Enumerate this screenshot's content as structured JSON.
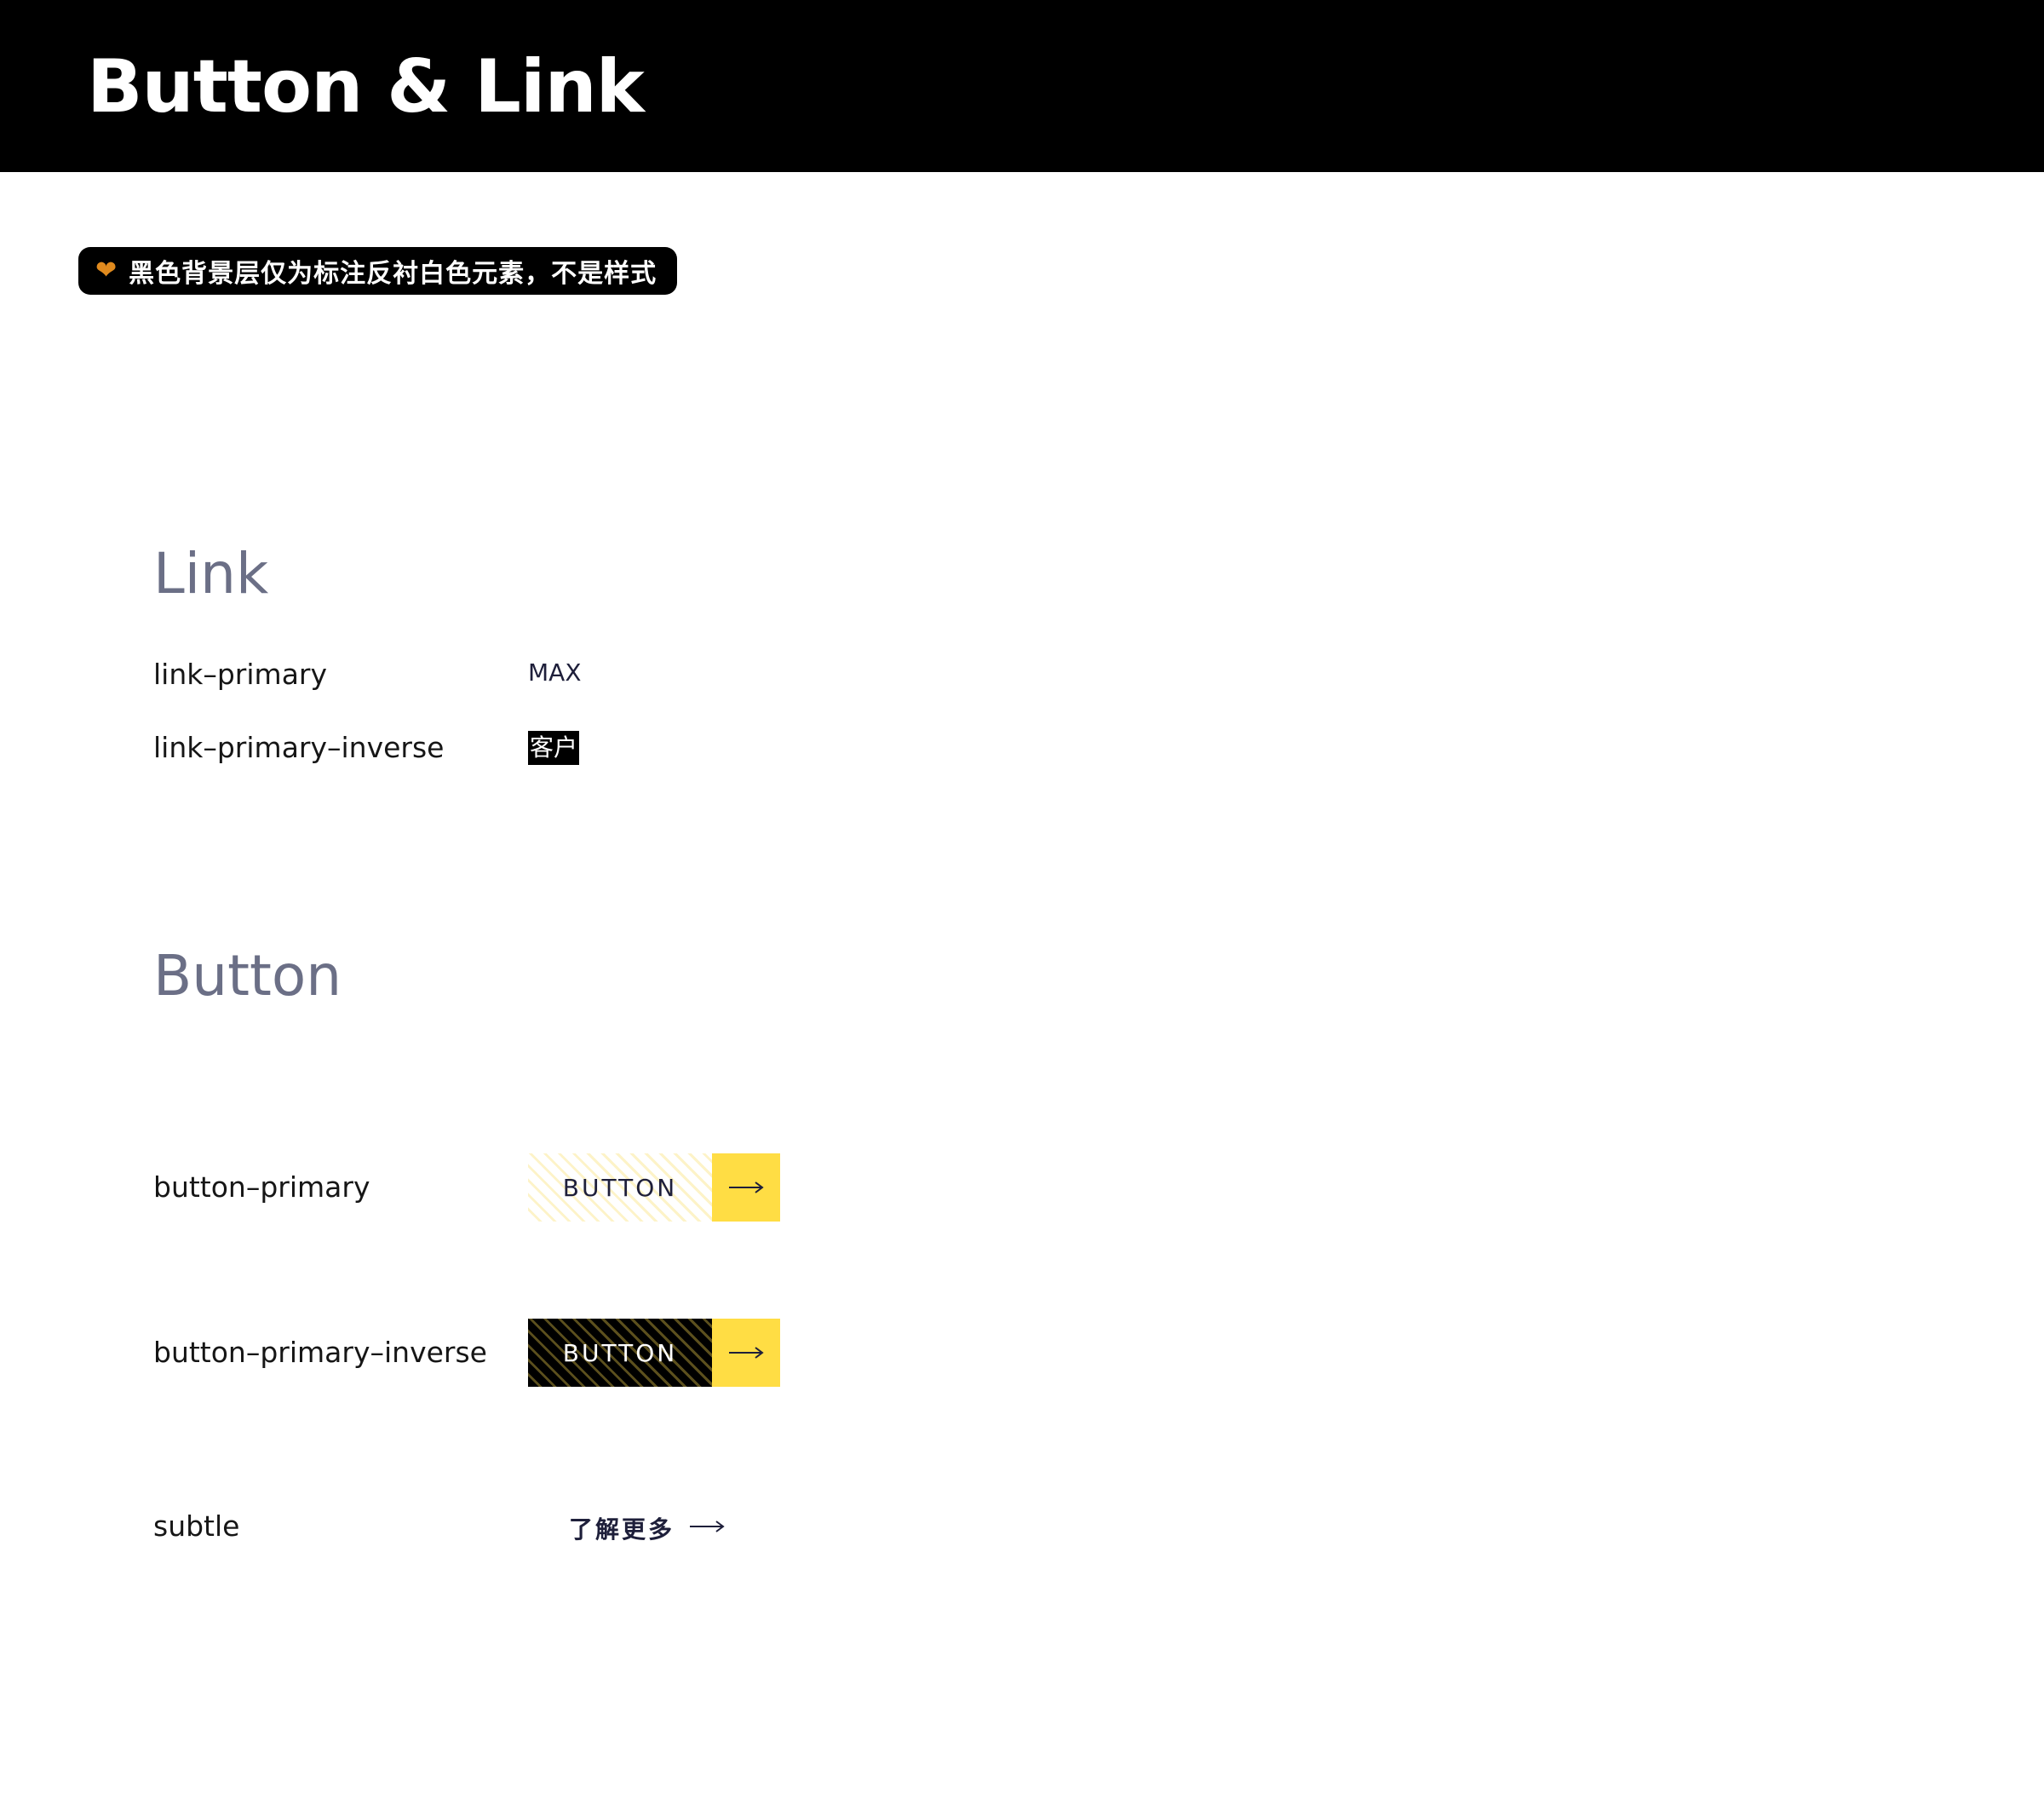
{
  "header": {
    "title": "Button & Link"
  },
  "notice": {
    "icon": "heart-icon",
    "text": "黑色背景层仅为标注反衬白色元素，不是样式"
  },
  "link_section": {
    "title": "Link",
    "rows": [
      {
        "label": "link–primary",
        "sample": "MAX"
      },
      {
        "label": "link–primary–inverse",
        "sample": "客户"
      }
    ]
  },
  "button_section": {
    "title": "Button",
    "rows": [
      {
        "label": "button–primary",
        "button_text": "BUTTON"
      },
      {
        "label": "button–primary–inverse",
        "button_text": "BUTTON"
      },
      {
        "label": "subtle",
        "button_text": "了解更多"
      }
    ]
  },
  "colors": {
    "header_bg": "#000000",
    "accent_yellow": "#ffdd44",
    "section_title": "#6b6f86",
    "link_text": "#1e1f3a",
    "notice_icon": "#e08a1e"
  }
}
